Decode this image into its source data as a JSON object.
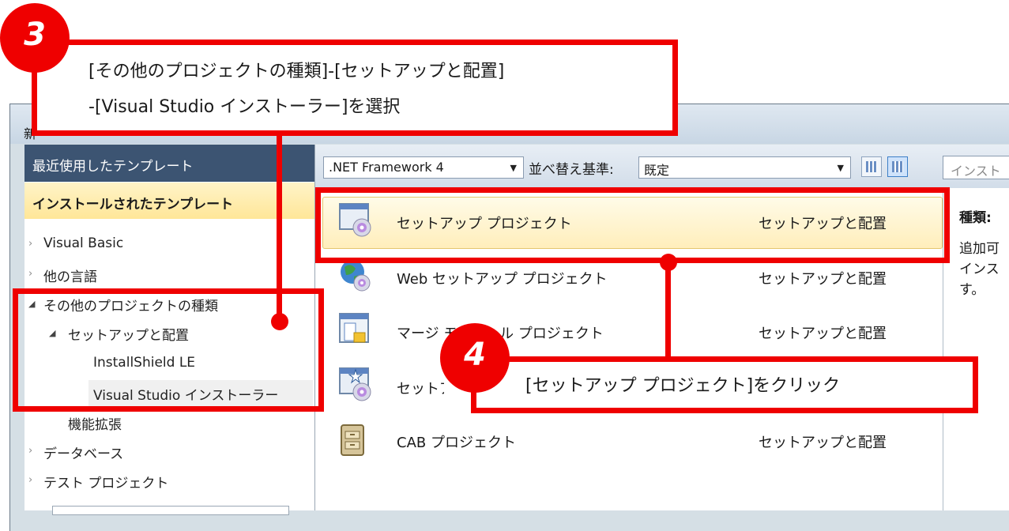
{
  "window": {
    "title_fragment": "新"
  },
  "left_panel": {
    "recent_label": "最近使用したテンプレート",
    "installed_label": "インストールされたテンプレート",
    "tree": [
      {
        "label": "Visual Basic",
        "state": "collapsed"
      },
      {
        "label": "他の言語",
        "state": "collapsed"
      },
      {
        "label": "その他のプロジェクトの種類",
        "state": "expanded"
      },
      {
        "label": "セットアップと配置",
        "state": "expanded"
      },
      {
        "label": "InstallShield LE",
        "state": "leaf"
      },
      {
        "label": "Visual Studio インストーラー",
        "state": "selected"
      },
      {
        "label": "機能拡張",
        "state": "leaf"
      },
      {
        "label": "データベース",
        "state": "collapsed"
      },
      {
        "label": "テスト プロジェクト",
        "state": "collapsed"
      }
    ]
  },
  "toolbar": {
    "framework_value": ".NET Framework 4",
    "sort_label": "並べ替え基準:",
    "sort_value": "既定",
    "search_placeholder": "インスト"
  },
  "templates": [
    {
      "name": "セットアップ プロジェクト",
      "category": "セットアップと配置",
      "icon": "setup-project-icon",
      "selected": true
    },
    {
      "name": "Web セットアップ プロジェクト",
      "category": "セットアップと配置",
      "icon": "web-setup-project-icon",
      "selected": false
    },
    {
      "name": "マージ モジュール プロジェクト",
      "category": "セットアップと配置",
      "icon": "merge-module-project-icon",
      "selected": false
    },
    {
      "name": "セットアップ ウィザード",
      "category": "",
      "icon": "setup-wizard-icon",
      "selected": false
    },
    {
      "name": "CAB プロジェクト",
      "category": "セットアップと配置",
      "icon": "cab-project-icon",
      "selected": false
    }
  ],
  "right_panel": {
    "kind_label": "種類:",
    "description_lines": [
      "追加可",
      "インス",
      "す。"
    ]
  },
  "annotations": {
    "step3_number": "3",
    "step3_line1": "[その他のプロジェクトの種類]-[セットアップと配置]",
    "step3_line2": "-[Visual Studio インストーラー]を選択",
    "step4_number": "4",
    "step4_text": "[セットアップ プロジェクト]をクリック",
    "accent_color": "#ef0000"
  }
}
